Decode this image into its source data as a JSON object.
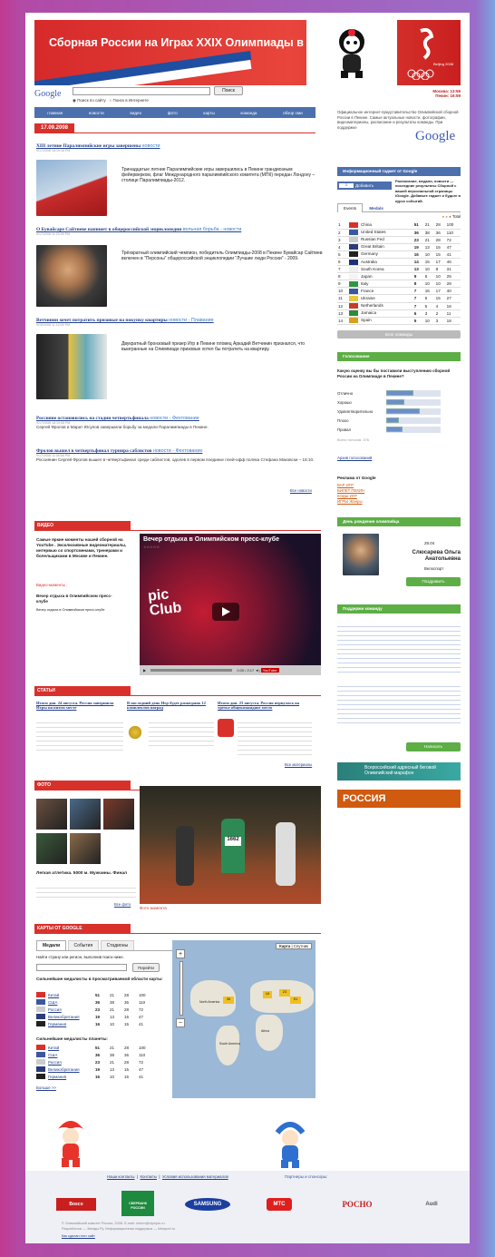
{
  "banner": {
    "title": "Сборная России на Играх XXIX Олимпиады в Пекине",
    "games": "Beijing 2008"
  },
  "search": {
    "google": "Google",
    "button": "Поиск",
    "radio1": "Поиск по сайту",
    "radio2": "Поиск в Интернете"
  },
  "nav": [
    "главная",
    "новости",
    "видео",
    "фото",
    "карты",
    "команда",
    "обзор сми"
  ],
  "date": "17.09.2008",
  "time": {
    "moscow": "Москва: 13:59",
    "beijing": "Пекин: 16:59"
  },
  "official": "Официальное интернет-представительство Олимпийской сборной России в Пекине. Самые актуальные новости, фотографии, видеоматериалы, расписание и результаты команды. При поддержке",
  "google_logo": "Google",
  "news": [
    {
      "title": "XIII летние Паралимпийские игры завершены",
      "cat": "новости",
      "date": "9/17/2008 18:19:18 PM",
      "text": "Тринадцатые летние Паралимпийские игры завершились в Пекине грандиозным фейерверком, флаг Международного паралимпийского комитета (МПК) передан Лондону – столице Паралимпиады-2012."
    },
    {
      "title": "О Бувайсаре Сайтиеве напишет в общероссийской энциклопедии",
      "cat": "вольная борьба - новости",
      "date": "9/17/2008 11:23:09 PM",
      "text": "Трёхкратный олимпийский чемпион, победитель Олимпиады-2008 в Пекине Бувайсар Сайтиев включен в \"Персоны\" общероссийской энциклопедии \"Лучшие люди России\" - 2009."
    },
    {
      "title": "Ветчинин хочет потратить призовые на покупку квартиры",
      "cat": "новости - Плавание",
      "date": "9/15/2008 11:10:00 PM",
      "text": "Двукратный бронзовый призер Игр в Пекине пловец Аркадий Ветчинин признался, что выигранные на Олимпиаде призовые хотел бы потратить на квартиру."
    },
    {
      "title": "Россияне остановились на стадии четвертьфинала",
      "cat": "новости - Фехтование",
      "date": "9/17/2008 18:19:06 PM",
      "text": "Сергей Фролов и Марат Юсупов завершили борьбу за медали Паралимпиады в Пекине."
    },
    {
      "title": "Фролов вышел в четвертьфинал турнира саблистов",
      "cat": "новости - Фехтование",
      "date": "9/17/2008 11:08:58 PM",
      "text": "Россиянин Сергей Фролов вышел в четвертьфинал среди саблистов, одолев в первом поединке плей-офф поляка Стефана Маковски – 15:10."
    }
  ],
  "more_news": "Все новости",
  "gadget": {
    "header": "Информационный гаджет от Google",
    "btn": "Добавить",
    "text": "Расписание, медали, новости — последние результаты Сборной с вашей персональной страницы iGoogle. Добавьте гаджет и будьте в курсе событий.",
    "tab1": "Events",
    "tab2": "Medals",
    "total": "Total"
  },
  "medals": [
    {
      "n": "1",
      "c": "China",
      "g": 51,
      "s": 21,
      "b": 28,
      "t": 100,
      "col": "#d8312c"
    },
    {
      "n": "2",
      "c": "United States",
      "g": 36,
      "s": 38,
      "b": 36,
      "t": 110,
      "col": "#3a57a0"
    },
    {
      "n": "3",
      "c": "Russian Fed",
      "g": 23,
      "s": 21,
      "b": 28,
      "t": 72,
      "col": "#ccc"
    },
    {
      "n": "4",
      "c": "Great Britain",
      "g": 19,
      "s": 13,
      "b": 15,
      "t": 47,
      "col": "#2a3c7a"
    },
    {
      "n": "5",
      "c": "Germany",
      "g": 16,
      "s": 10,
      "b": 15,
      "t": 41,
      "col": "#222"
    },
    {
      "n": "6",
      "c": "Australia",
      "g": 14,
      "s": 15,
      "b": 17,
      "t": 46,
      "col": "#1c2f78"
    },
    {
      "n": "7",
      "c": "South Korea",
      "g": 13,
      "s": 10,
      "b": 8,
      "t": 31,
      "col": "#eee"
    },
    {
      "n": "8",
      "c": "Japan",
      "g": 9,
      "s": 6,
      "b": 10,
      "t": 25,
      "col": "#f4f4f4"
    },
    {
      "n": "9",
      "c": "Italy",
      "g": 8,
      "s": 10,
      "b": 10,
      "t": 28,
      "col": "#2e9a3f"
    },
    {
      "n": "10",
      "c": "France",
      "g": 7,
      "s": 16,
      "b": 17,
      "t": 40,
      "col": "#3a57a0"
    },
    {
      "n": "11",
      "c": "Ukraine",
      "g": 7,
      "s": 5,
      "b": 15,
      "t": 27,
      "col": "#e8c73a"
    },
    {
      "n": "12",
      "c": "Netherlands",
      "g": 7,
      "s": 5,
      "b": 4,
      "t": 16,
      "col": "#c83a2a"
    },
    {
      "n": "13",
      "c": "Jamaica",
      "g": 6,
      "s": 3,
      "b": 2,
      "t": 11,
      "col": "#2e8a3f"
    },
    {
      "n": "14",
      "c": "Spain",
      "g": 5,
      "s": 10,
      "b": 3,
      "t": 18,
      "col": "#d8a020"
    }
  ],
  "team_blog": "Блог команды",
  "poll": {
    "header": "Голосование",
    "q": "Какую оценку вы бы поставили выступлению сборной России на Олимпиаде в Пекине?",
    "opts": [
      "Отлично",
      "Хорошо",
      "Удовлетворительно",
      "Плохо",
      "Провал"
    ],
    "vals": [
      25,
      17,
      31,
      12,
      15
    ],
    "total": "Всего голосов: 376",
    "archive": "Архив голосований"
  },
  "ads": {
    "header": "Реклама от Google",
    "items": [
      "ВАР ИГР",
      "БИЛЕТ ПЕКИН",
      "КОДЫ ИГР",
      "ИГРЫ Жанры"
    ]
  },
  "bday": {
    "header": "День рождения олимпийца",
    "date": "28.04",
    "name": "Слюсарева Ольга Анатольевна",
    "sport": "Велоспорт",
    "btn": "Поздравить"
  },
  "support": {
    "header": "Поддержи команду",
    "btn": "Написать"
  },
  "video": {
    "header": "ВИДЕО",
    "title": "Вечер отдыха в Олимпийском пресс-клубе",
    "text1": "Самые яркие моменты нашей сборной на YouTube . Эксклюзивные видеоматериалы, интервью со спортсменами, тренерами и болельщиками в Москве и Пекине.",
    "link": "Видео-моменты ;",
    "text2": "Вечер отдыха в Олимпийском пресс-клубе",
    "text3": "Вечер отдыха в Олимпийском пресс-клубе",
    "time": "0:00 / 2:17"
  },
  "articles": {
    "header": "СТАТЬИ",
    "items": [
      "Итоги дня. 24 августа. Россия завершила Игры на пятом месте",
      "В последний день Игр будет разыграно 12 комплектов наград",
      "Итоги дня. 23 августа. Россия вернулась на третье общекомандное место"
    ],
    "more": "Все материалы"
  },
  "photo": {
    "header": "ФОТО",
    "caption": "Легкая атлетика. 5000 м. Мужчины. Финал",
    "more": "Все фото",
    "moment": "Фото момента",
    "bib": "1662"
  },
  "maps": {
    "header": "КАРТЫ ОТ GOOGLE",
    "tabs": [
      "Медали",
      "События",
      "Стадионы"
    ],
    "find": "Найти страну или регион, выполнив поиск ниже.",
    "go": "Перейти",
    "sub1": "Сильнейшие медалисты в просматриваемой области карты:",
    "sub2": "Сильнейшие медалисты планеты:",
    "more": "Больше >>",
    "map_btn": "Карта",
    "sat_btn": "Спутник",
    "countries": [
      "Китай",
      "США",
      "Россия",
      "Великобритания",
      "Германия"
    ],
    "rows": [
      [
        51,
        21,
        28,
        100
      ],
      [
        36,
        38,
        36,
        110
      ],
      [
        23,
        21,
        28,
        72
      ],
      [
        19,
        13,
        15,
        47
      ],
      [
        16,
        10,
        15,
        41
      ]
    ],
    "na": "North America",
    "sa": "South America",
    "af": "Africa"
  },
  "footer": {
    "links": [
      "Наши контакты",
      "Контакты",
      "Условия использования материалов"
    ],
    "partners": "Партнеры и спонсоры:",
    "sponsors": [
      "Bosco",
      "СБЕРБАНК РОССИИ",
      "SAMSUNG",
      "МТС",
      "РОСНО",
      "Audi"
    ],
    "copy": "© Олимпийский комитет России, 2008. E-mail: inform@olympic.ru",
    "made": "Разработчик — Звезды.Ру. Информационная поддержка — Infosport.ru",
    "how": "Как сделан этот сайт"
  },
  "marathon": "Всероссийский адресный беговой Олимпийский марафон",
  "russia": "РОССИЯ"
}
